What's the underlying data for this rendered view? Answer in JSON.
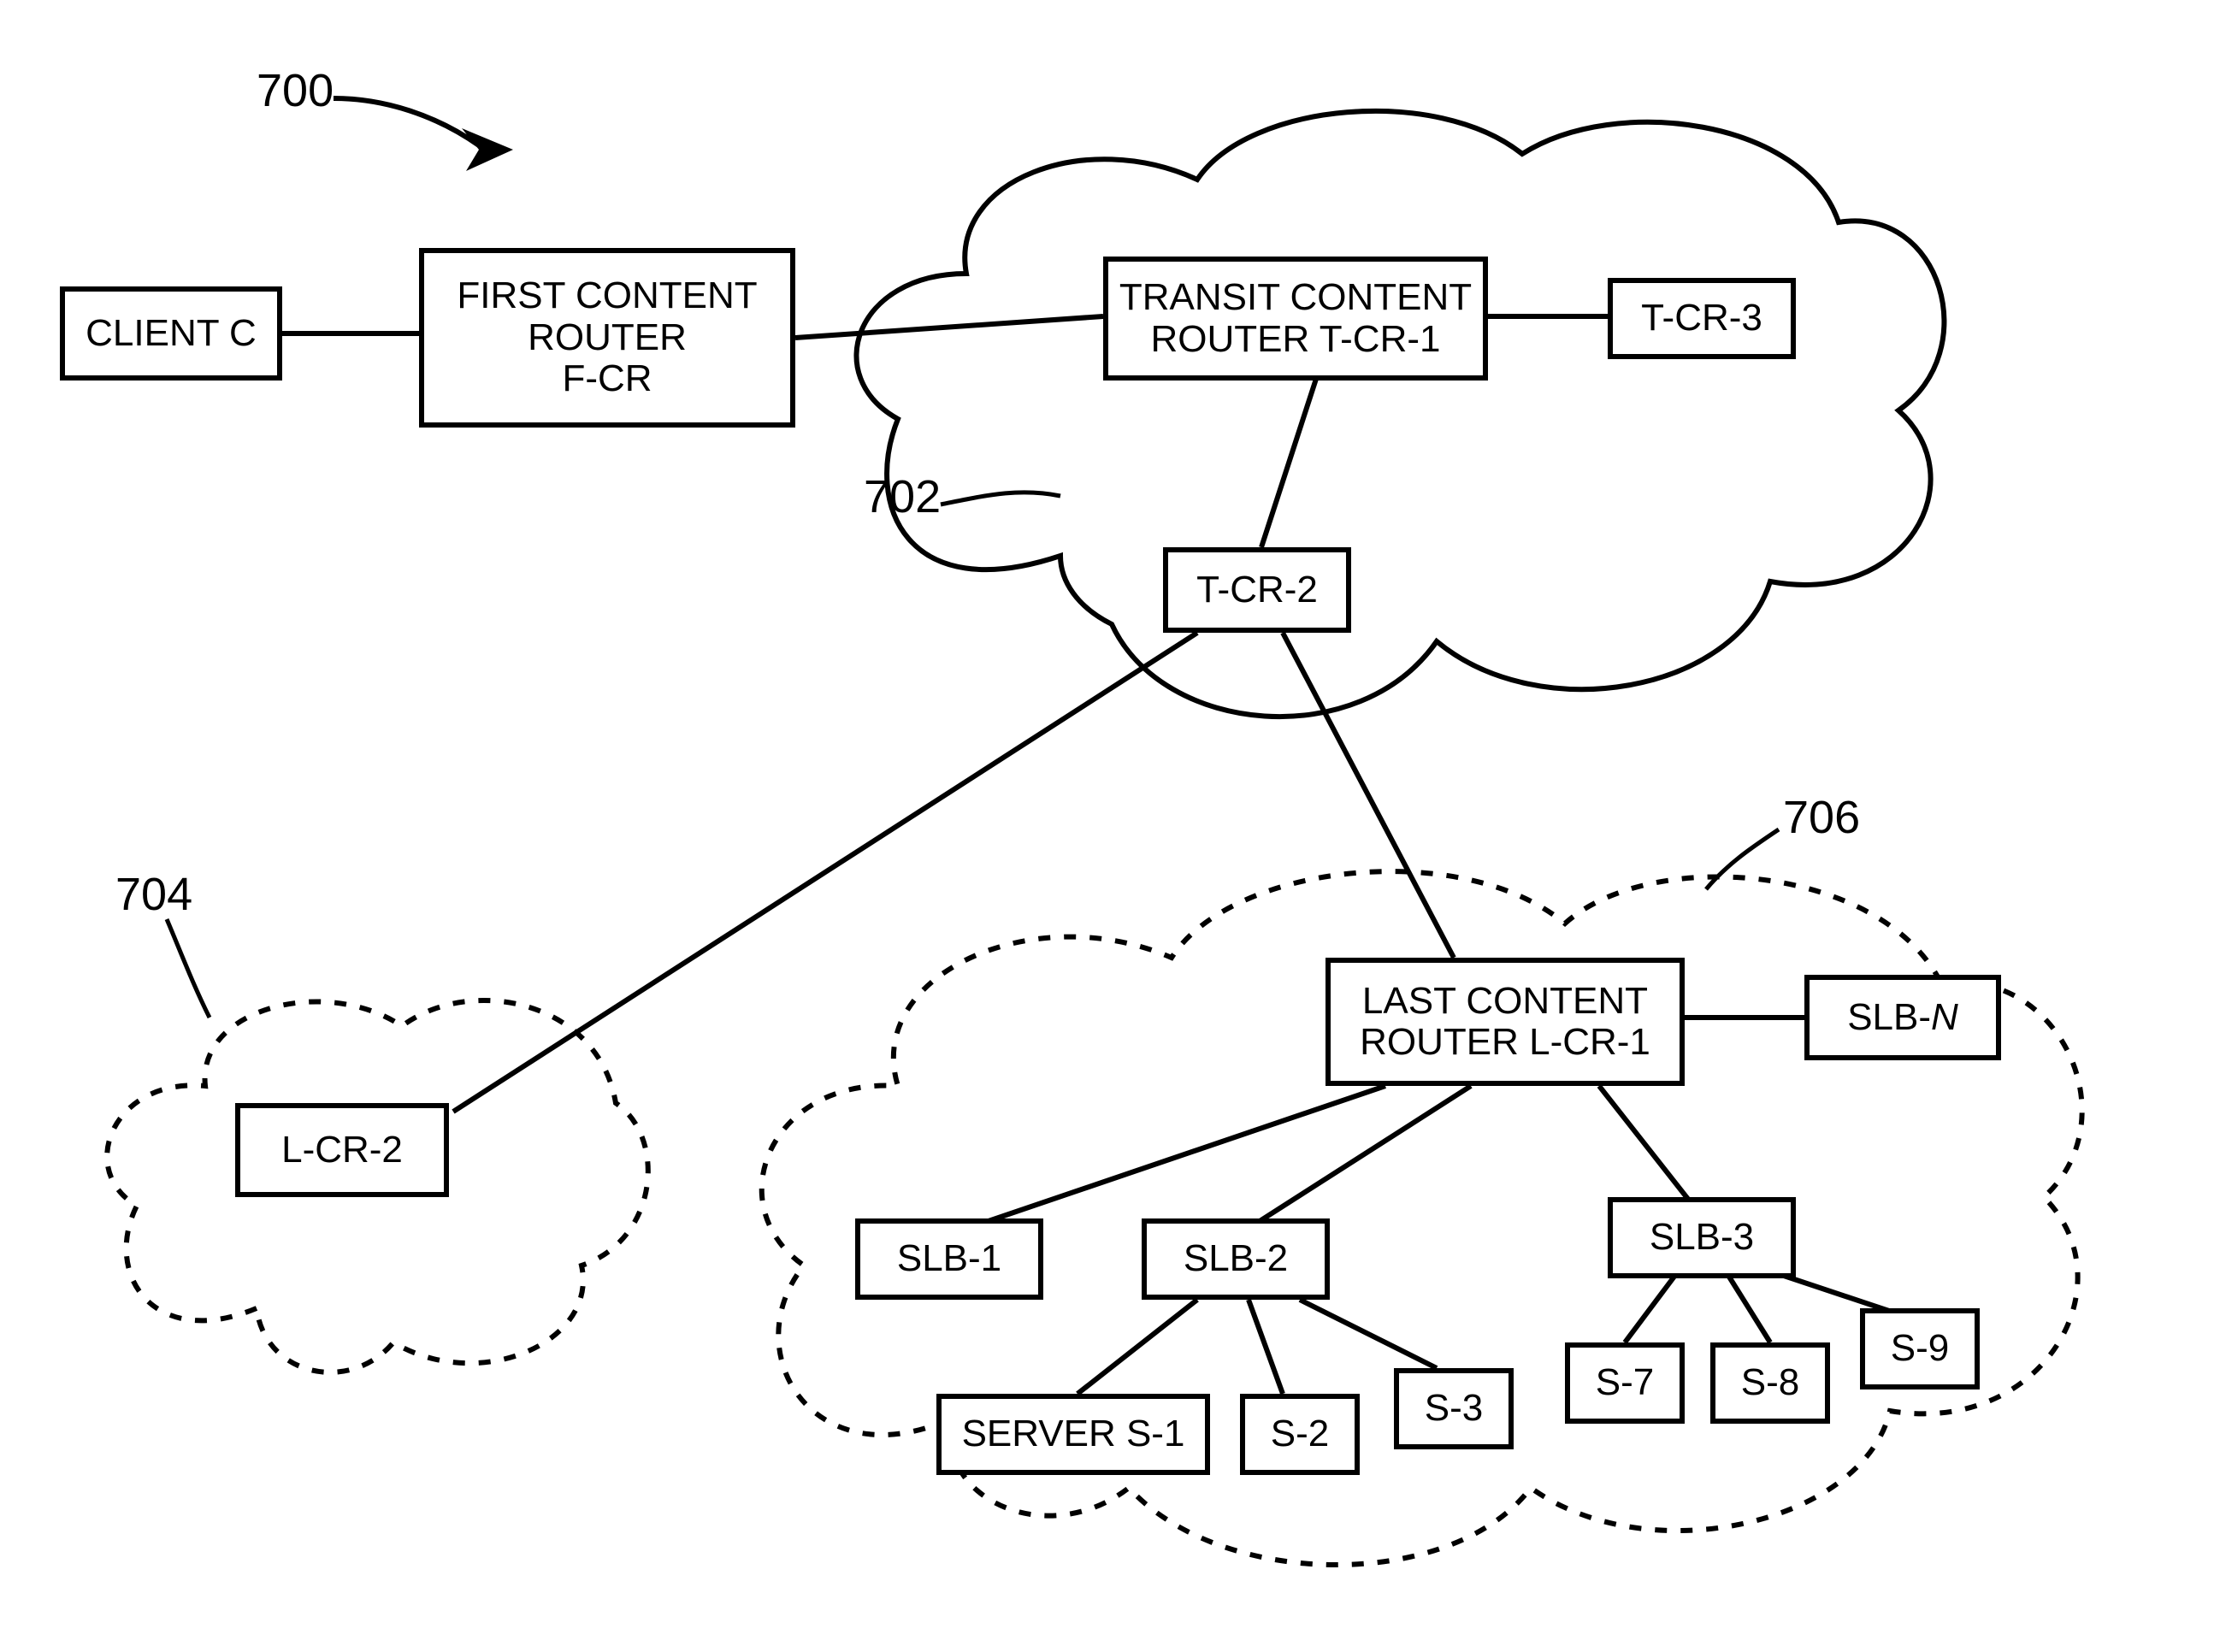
{
  "refs": {
    "main": "700",
    "cloud_top": "702",
    "cloud_left": "704",
    "cloud_right": "706"
  },
  "nodes": {
    "client": {
      "label": "CLIENT C"
    },
    "fcr": {
      "label": "FIRST CONTENT\nROUTER\nF-CR"
    },
    "tcr1": {
      "label": "TRANSIT CONTENT\nROUTER T-CR-1"
    },
    "tcr3": {
      "label": "T-CR-3"
    },
    "tcr2": {
      "label": "T-CR-2"
    },
    "lcr2": {
      "label": "L-CR-2"
    },
    "lcr1": {
      "label": "LAST CONTENT\nROUTER L-CR-1"
    },
    "slbN": {
      "label": "SLB-N"
    },
    "slb1": {
      "label": "SLB-1"
    },
    "slb2": {
      "label": "SLB-2"
    },
    "slb3": {
      "label": "SLB-3"
    },
    "s1": {
      "label": "SERVER S-1"
    },
    "s2": {
      "label": "S-2"
    },
    "s3": {
      "label": "S-3"
    },
    "s7": {
      "label": "S-7"
    },
    "s8": {
      "label": "S-8"
    },
    "s9": {
      "label": "S-9"
    }
  }
}
